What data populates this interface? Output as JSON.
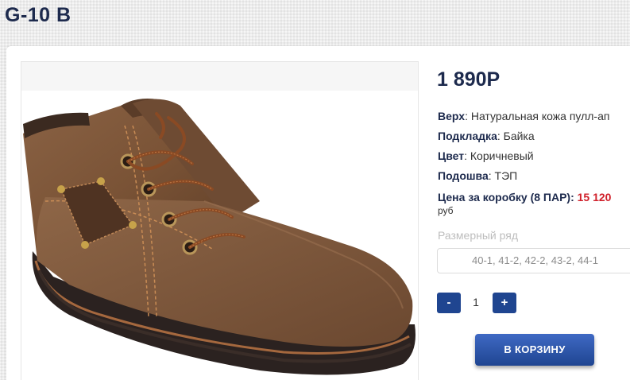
{
  "product": {
    "title": "G-10 B",
    "price": "1 890Р",
    "image_alt": "brown leather boot"
  },
  "specs": [
    {
      "label": "Верх",
      "value": "Натуральная кожа пулл-ап"
    },
    {
      "label": "Подкладка",
      "value": "Байка"
    },
    {
      "label": "Цвет",
      "value": "Коричневый"
    },
    {
      "label": "Подошва",
      "value": "ТЭП"
    }
  ],
  "box_price": {
    "label": "Цена за коробку (8 ПАР):",
    "value": "15 120",
    "unit": "руб"
  },
  "size": {
    "label": "Размерный ряд",
    "selected": "40-1, 41-2, 42-2, 43-2, 44-1"
  },
  "quantity": {
    "minus_label": "-",
    "value": "1",
    "plus_label": "+"
  },
  "cart_button": "В КОРЗИНУ",
  "colors": {
    "title": "#1d2a4d",
    "accent": "#1f4590",
    "price_red": "#d0202a"
  }
}
